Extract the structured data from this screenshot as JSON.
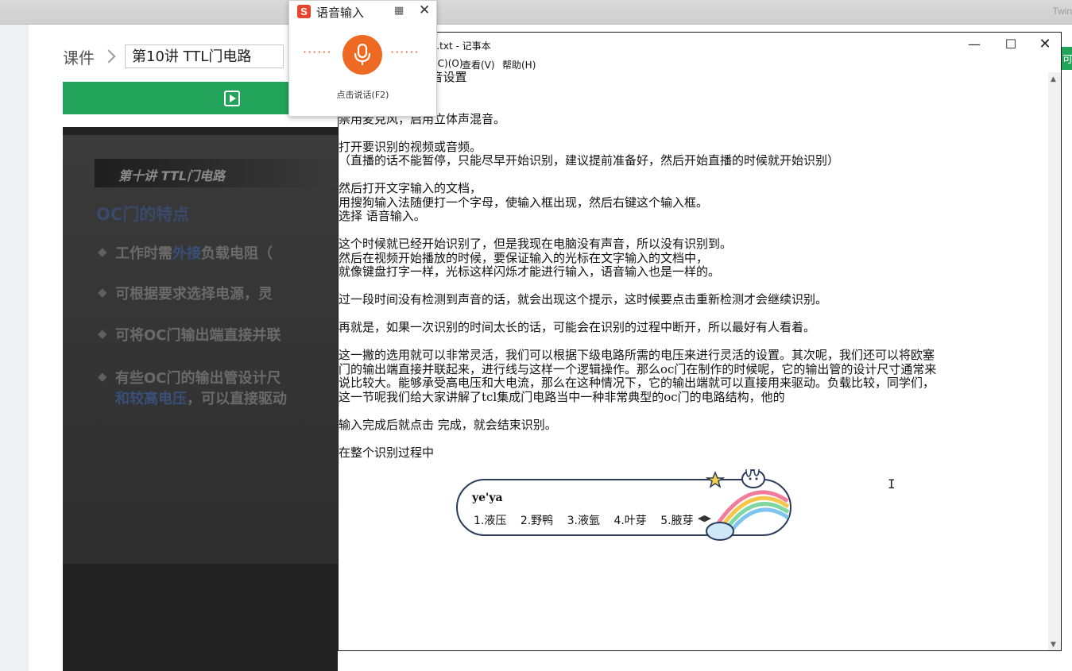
{
  "browser": {
    "corner_text": "Twin"
  },
  "course": {
    "breadcrumb_label": "课件",
    "lesson_select": "第10讲 TTL门电路"
  },
  "slide": {
    "banner": "第十讲  TTL门电路",
    "heading": "OC门的特点",
    "bullets": [
      {
        "pre": "工作时需",
        "blue": "外接",
        "post": "负载电阻（"
      },
      {
        "pre": "可根据要求选择电源，灵",
        "blue": "",
        "post": ""
      },
      {
        "pre": "可将OC门输出端直接并联",
        "blue": "",
        "post": ""
      },
      {
        "pre": "有些OC门的输出管设计尺",
        "blue": "",
        "post": ""
      }
    ],
    "last_line_blue": "和较高电压",
    "last_line_rest": "，可以直接驱动"
  },
  "voice_input": {
    "title": "语音输入",
    "grid_icon": "grid-icon",
    "close_icon": "close-icon",
    "hint": "点击说话(F2)"
  },
  "notepad": {
    "title": "l.txt - 记事本",
    "menus": [
      "(C)(O)",
      "查看(V)",
      "帮助(H)"
    ],
    "text_lines": [
      "               打开声音设置",
      "               板。",
      "",
      "禁用麦克风，启用立体声混音。",
      "",
      "打开要识别的视频或音频。",
      "（直播的话不能暂停，只能尽早开始识别，建议提前准备好，然后开始直播的时候就开始识别）",
      "",
      "然后打开文字输入的文档，",
      "用搜狗输入法随便打一个字母，使输入框出现，然后右键这个输入框。",
      "选择 语音输入。",
      "",
      "这个时候就已经开始识别了，但是我现在电脑没有声音，所以没有识别到。",
      "然后在视频开始播放的时候，要保证输入的光标在文字输入的文档中，",
      "就像键盘打字一样，光标这样闪烁才能进行输入，语音输入也是一样的。",
      "",
      "过一段时间没有检测到声音的话，就会出现这个提示，这时候要点击重新检测才会继续识别。",
      "",
      "再就是，如果一次识别的时间太长的话，可能会在识别的过程中断开，所以最好有人看着。",
      "",
      "这一撇的选用就可以非常灵活，我们可以根据下级电路所需的电压来进行灵活的设置。其次呢，我们还可以将欧塞",
      "门的输出端直接并联起来，进行线与这样一个逻辑操作。那么oc门在制作的时候呢，它的输出管的设计尺寸通常来",
      "说比较大。能够承受高电压和大电流，那么在这种情况下，它的输出端就可以直接用来驱动。负载比较，同学们，",
      "这一节呢我们给大家讲解了tcl集成门电路当中一种非常典型的oc门的电路结构，他的",
      "",
      "输入完成后就点击 完成，就会结束识别。",
      "",
      "在整个识别过程中"
    ]
  },
  "ime": {
    "composition": "ye'ya",
    "candidates": [
      "1.液压",
      "2.野鸭",
      "3.液氩",
      "4.叶芽",
      "5.腋芽"
    ]
  },
  "colors": {
    "green": "#21a35a",
    "mic_orange": "#ee6a22",
    "ime_border": "#2a3b5c"
  }
}
